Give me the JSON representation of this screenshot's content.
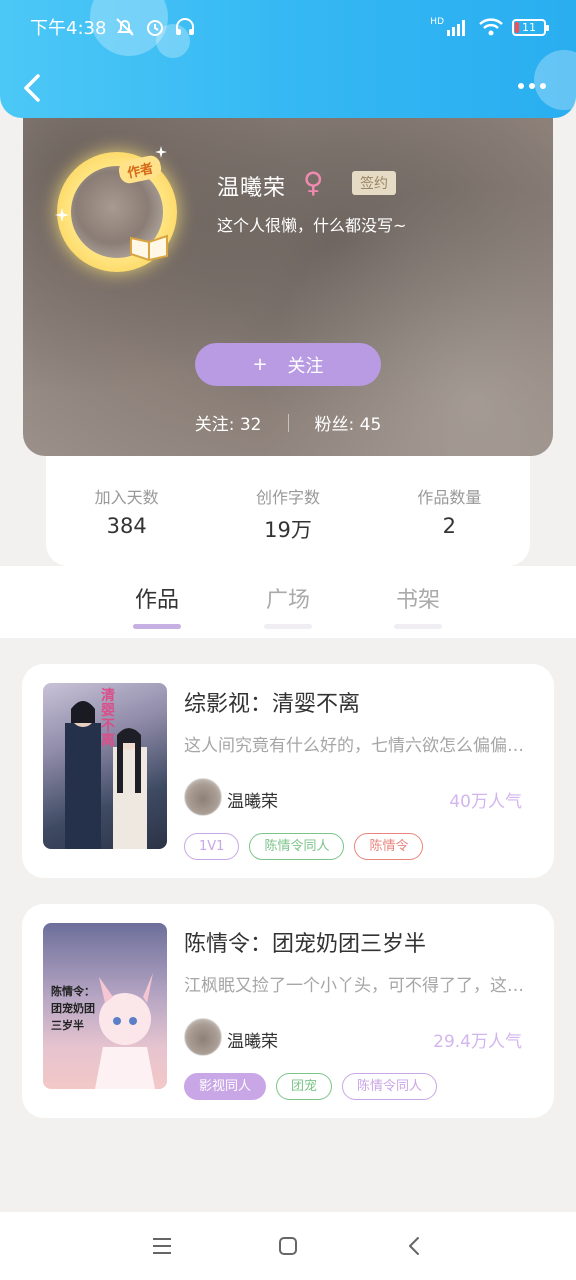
{
  "status": {
    "time": "下午4:38",
    "battery": "11",
    "hd_label": "HD"
  },
  "header": {
    "back_icon": "chevron-left-icon",
    "more_icon": "more-dots-icon"
  },
  "profile": {
    "author_tag": "作者",
    "name": "温曦荣",
    "gender_symbol": "♀",
    "sign_badge": "签约",
    "bio": "这个人很懒，什么都没写~",
    "follow_button": "关注",
    "follow_plus": "+",
    "following": "关注: 32",
    "fans": "粉丝: 45"
  },
  "stats": [
    {
      "label": "加入天数",
      "value": "384"
    },
    {
      "label": "创作字数",
      "value": "19万"
    },
    {
      "label": "作品数量",
      "value": "2"
    }
  ],
  "tabs": [
    {
      "label": "作品",
      "active": true
    },
    {
      "label": "广场",
      "active": false
    },
    {
      "label": "书架",
      "active": false
    }
  ],
  "books": [
    {
      "title": "综影视：清婴不离",
      "desc": "这人间究竟有什么好的，七情六欲怎么偏偏都要经历一遍",
      "author": "温曦荣",
      "popularity": "40万人气",
      "cover_text": "清婴不离",
      "tags": [
        {
          "label": "1V1",
          "color": "#c9a6e6",
          "fill": ""
        },
        {
          "label": "陈情令同人",
          "color": "#7bc48a",
          "fill": ""
        },
        {
          "label": "陈情令",
          "color": "#e8857e",
          "fill": ""
        }
      ]
    },
    {
      "title": "陈情令：团宠奶团三岁半",
      "desc": "江枫眠又捡了一个小丫头，可不得了了，这下莲花坞热闹了",
      "author": "温曦荣",
      "popularity": "29.4万人气",
      "cover_text": "陈情令：团宠奶团三岁半",
      "tags": [
        {
          "label": "影视同人",
          "color": "#ffffff",
          "fill": "#c9a6e6"
        },
        {
          "label": "团宠",
          "color": "#7bc48a",
          "fill": ""
        },
        {
          "label": "陈情令同人",
          "color": "#c9a6e6",
          "fill": ""
        }
      ]
    }
  ],
  "navbar": {
    "menu_icon": "menu-icon",
    "home_icon": "home-square-icon",
    "back_icon": "back-triangle-icon"
  }
}
